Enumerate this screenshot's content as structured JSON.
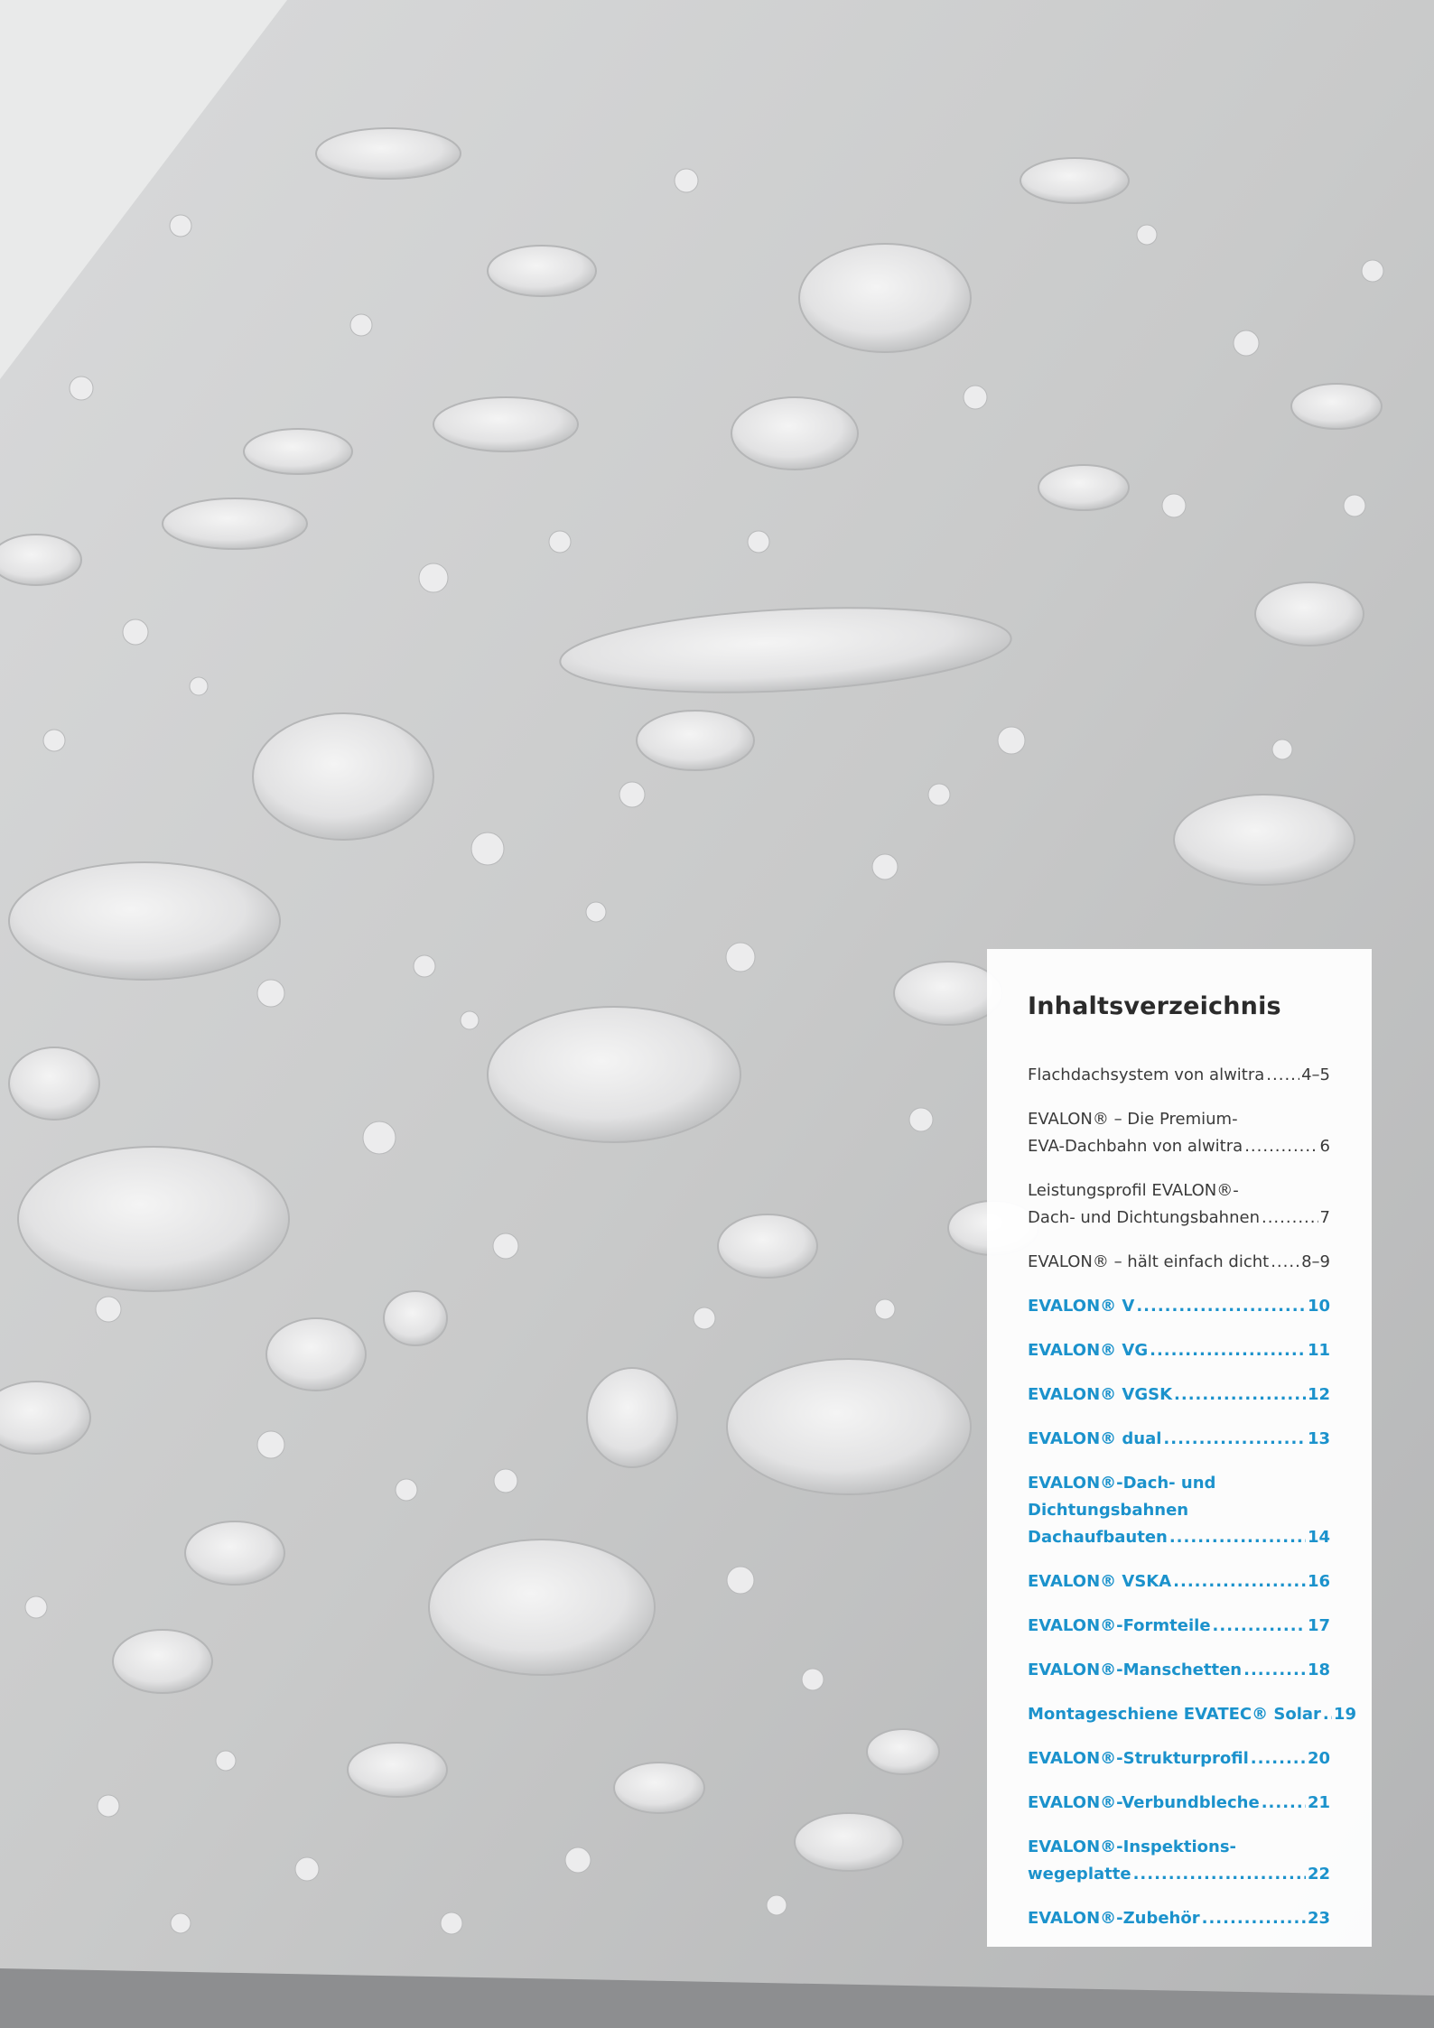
{
  "toc": {
    "title": "Inhaltsverzeichnis",
    "entries": [
      {
        "pre": "",
        "label": "Flachdachsystem von alwitra",
        "page": "4–5",
        "style": "gray"
      },
      {
        "pre": "EVALON® – Die Premium-",
        "label": "EVA-Dachbahn von alwitra",
        "page": "6",
        "style": "gray"
      },
      {
        "pre": "Leistungsprofil EVALON®-",
        "label": "Dach- und Dichtungsbahnen",
        "page": "7",
        "style": "gray"
      },
      {
        "pre": "",
        "label": "EVALON® – hält einfach dicht",
        "page": "8–9",
        "style": "gray"
      },
      {
        "pre": "",
        "label": "EVALON® V",
        "page": "10",
        "style": "blue"
      },
      {
        "pre": "",
        "label": "EVALON® VG",
        "page": "11",
        "style": "blue"
      },
      {
        "pre": "",
        "label": "EVALON® VGSK",
        "page": "12",
        "style": "blue"
      },
      {
        "pre": "",
        "label": "EVALON® dual",
        "page": "13",
        "style": "blue"
      },
      {
        "pre": "EVALON®-Dach- und\nDichtungsbahnen",
        "label": "Dachaufbauten",
        "page": "14",
        "style": "blue"
      },
      {
        "pre": "",
        "label": "EVALON® VSKA",
        "page": "16",
        "style": "blue"
      },
      {
        "pre": "",
        "label": "EVALON®-Formteile",
        "page": "17",
        "style": "blue"
      },
      {
        "pre": "",
        "label": "EVALON®-Manschetten",
        "page": "18",
        "style": "blue"
      },
      {
        "pre": "",
        "label": "Montageschiene EVATEC® Solar",
        "page": "19",
        "style": "blue"
      },
      {
        "pre": "",
        "label": "EVALON®-Strukturprofil",
        "page": "20",
        "style": "blue"
      },
      {
        "pre": "",
        "label": "EVALON®-Verbundbleche",
        "page": "21",
        "style": "blue"
      },
      {
        "pre": "EVALON®-Inspektions-",
        "label": "wegeplatte",
        "page": "22",
        "style": "blue"
      },
      {
        "pre": "",
        "label": "EVALON®-Zubehör",
        "page": "23",
        "style": "blue"
      }
    ]
  }
}
